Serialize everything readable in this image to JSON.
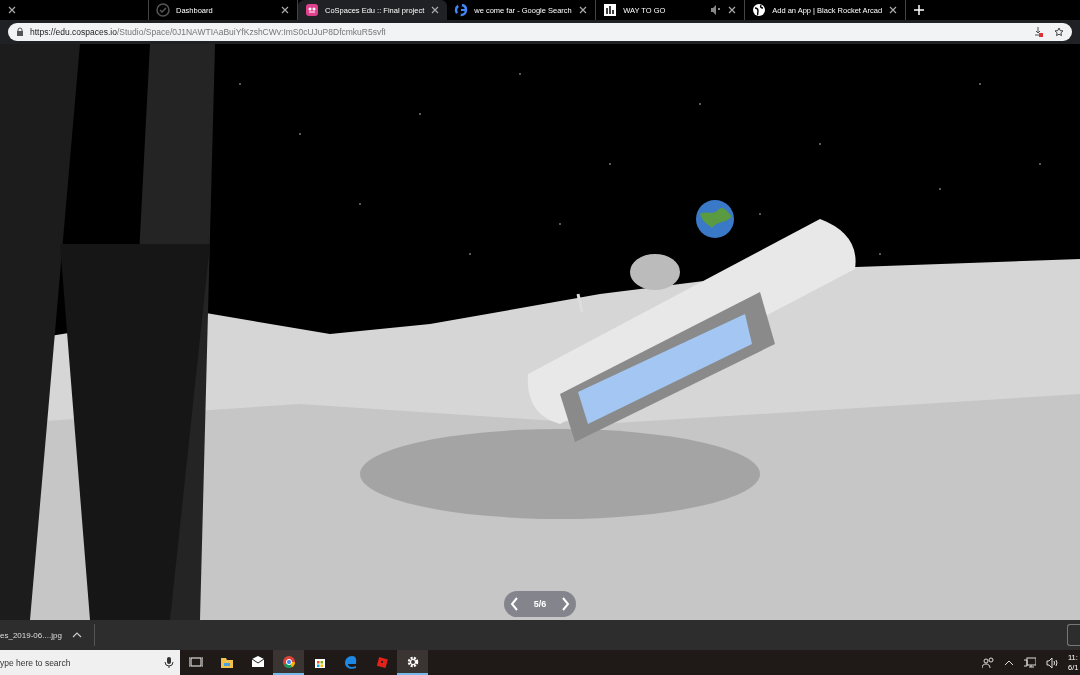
{
  "tabs": [
    {
      "selected": false
    },
    {
      "title": "Dashboard",
      "selected": false
    },
    {
      "title": "CoSpaces Edu :: Final project",
      "selected": true
    },
    {
      "title": "we come far - Google Search",
      "selected": false
    },
    {
      "title": "WAY TO GO",
      "selected": false,
      "muted": true
    },
    {
      "title": "Add an App | Black Rocket Arcad",
      "selected": false
    }
  ],
  "address": {
    "host": "https://edu.cospaces.io",
    "path": "/Studio/Space/0J1NAWTIAaBuiYfKzshCWv:ImS0cUJuP8DfcmkuR5svfI"
  },
  "scene": {
    "pager": "5/6"
  },
  "download": {
    "file": "es_2019-06....jpg"
  },
  "taskbar": {
    "search_placeholder": "ype here to search",
    "apps": [
      {
        "kind": "taskview",
        "running": false
      },
      {
        "kind": "folder",
        "running": false
      },
      {
        "kind": "mail",
        "running": false
      },
      {
        "kind": "chrome",
        "running": true
      },
      {
        "kind": "store",
        "running": false
      },
      {
        "kind": "edge",
        "running": false
      },
      {
        "kind": "roblox",
        "running": false
      },
      {
        "kind": "gear",
        "running": true
      }
    ],
    "clock": {
      "time": "11:",
      "date": "6/1"
    }
  }
}
